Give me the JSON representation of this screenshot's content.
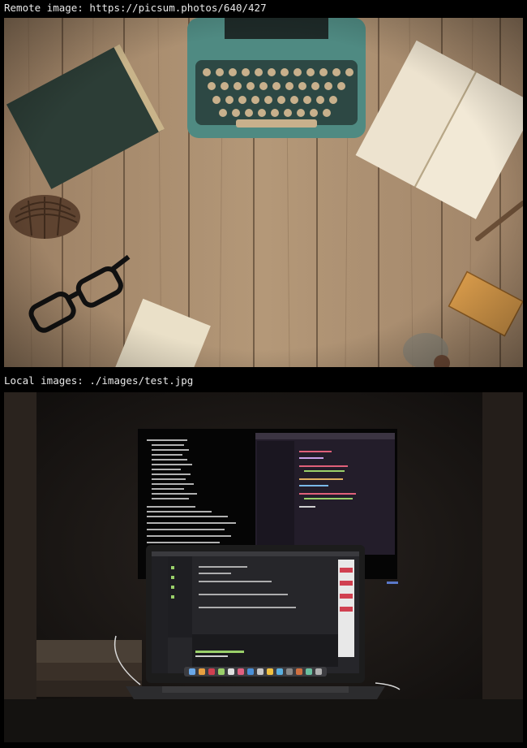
{
  "remote_section": {
    "caption": "Remote image: https://picsum.photos/640/427",
    "image_alt": "Wooden desk with typewriter, notebooks, glasses and pine cone"
  },
  "local_section": {
    "caption": "Local images: ./images/test.jpg",
    "image_alt": "Laptop and monitor with code editor in a dark room"
  },
  "colors": {
    "page_background": "#000000",
    "caption_text": "#e8e8e8",
    "wood": "#a88a6a",
    "typewriter": "#4f8a82"
  }
}
